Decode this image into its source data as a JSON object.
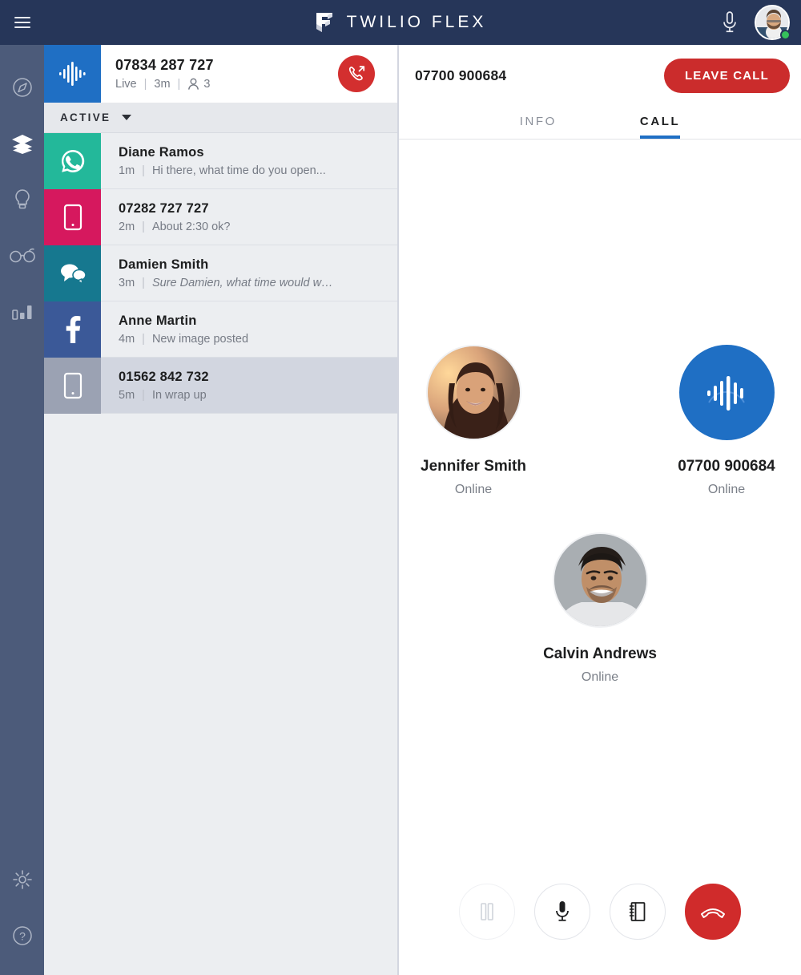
{
  "topbar": {
    "menu_icon": "hamburger-icon",
    "logo_icon": "twilio-flex-logo",
    "brand": "TWILIO FLEX",
    "mic_icon": "microphone-icon",
    "avatar_name": "agent-avatar",
    "presence": "online"
  },
  "rail": {
    "items": [
      {
        "icon": "compass-icon",
        "name": "navigate",
        "active": false
      },
      {
        "icon": "layers-icon",
        "name": "tasks",
        "active": true
      },
      {
        "icon": "lightbulb-icon",
        "name": "insights",
        "active": false
      },
      {
        "icon": "glasses-icon",
        "name": "monitor",
        "active": false
      },
      {
        "icon": "bar-chart-icon",
        "name": "analytics",
        "active": false
      }
    ],
    "bottom_items": [
      {
        "icon": "gear-icon",
        "name": "settings"
      },
      {
        "icon": "help-icon",
        "name": "help"
      }
    ]
  },
  "active_task": {
    "channel_icon": "voice-waveform-icon",
    "title": "07834 287 727",
    "status": "Live",
    "duration": "3m",
    "participants_icon": "person-icon",
    "participants": "3",
    "transfer_icon": "call-transfer-icon"
  },
  "filter": {
    "label": "ACTIVE",
    "caret_icon": "chevron-down-icon"
  },
  "tasks": [
    {
      "channel_icon": "whatsapp-icon",
      "channel_color": "#23B89A",
      "title": "Diane Ramos",
      "time": "1m",
      "preview": "Hi there, what time do you open...",
      "italic": false,
      "wrapup": false
    },
    {
      "channel_icon": "sms-icon",
      "channel_color": "#D6185E",
      "title": "07282 727 727",
      "time": "2m",
      "preview": "About 2:30 ok?",
      "italic": false,
      "wrapup": false
    },
    {
      "channel_icon": "chat-icon",
      "channel_color": "#16788F",
      "title": "Damien Smith",
      "time": "3m",
      "preview": "Sure Damien, what time would w…",
      "italic": true,
      "wrapup": false
    },
    {
      "channel_icon": "facebook-icon",
      "channel_color": "#3B5998",
      "title": "Anne Martin",
      "time": "4m",
      "preview": "New image posted",
      "italic": false,
      "wrapup": false
    },
    {
      "channel_icon": "sms-icon",
      "channel_color": "#9BA2B3",
      "title": "01562 842 732",
      "time": "5m",
      "preview": "In wrap up",
      "italic": false,
      "wrapup": true
    }
  ],
  "call": {
    "number": "07700 900684",
    "leave_label": "LEAVE CALL",
    "tabs": [
      {
        "label": "INFO",
        "active": false
      },
      {
        "label": "CALL",
        "active": true
      }
    ],
    "participants": [
      {
        "name": "Jennifer Smith",
        "status": "Online",
        "avatar": "photo-jennifer"
      },
      {
        "name": "07700 900684",
        "status": "Online",
        "avatar": "voice-waveform-icon"
      },
      {
        "name": "Calvin Andrews",
        "status": "Online",
        "avatar": "photo-calvin"
      }
    ],
    "controls": [
      {
        "icon": "hold-pause-icon",
        "name": "hold-button",
        "state": "disabled"
      },
      {
        "icon": "microphone-icon",
        "name": "mute-button",
        "state": "enabled"
      },
      {
        "icon": "directory-icon",
        "name": "directory-button",
        "state": "enabled"
      },
      {
        "icon": "hangup-icon",
        "name": "hangup-button",
        "state": "danger"
      }
    ]
  },
  "colors": {
    "topbar": "#263659",
    "rail": "#4C5B7A",
    "accent_blue": "#1F6FC4",
    "danger_red": "#CB2C2C",
    "panel_bg": "#ECEEF1",
    "wrapup_bg": "#D2D6E0",
    "online_green": "#36C15B"
  }
}
